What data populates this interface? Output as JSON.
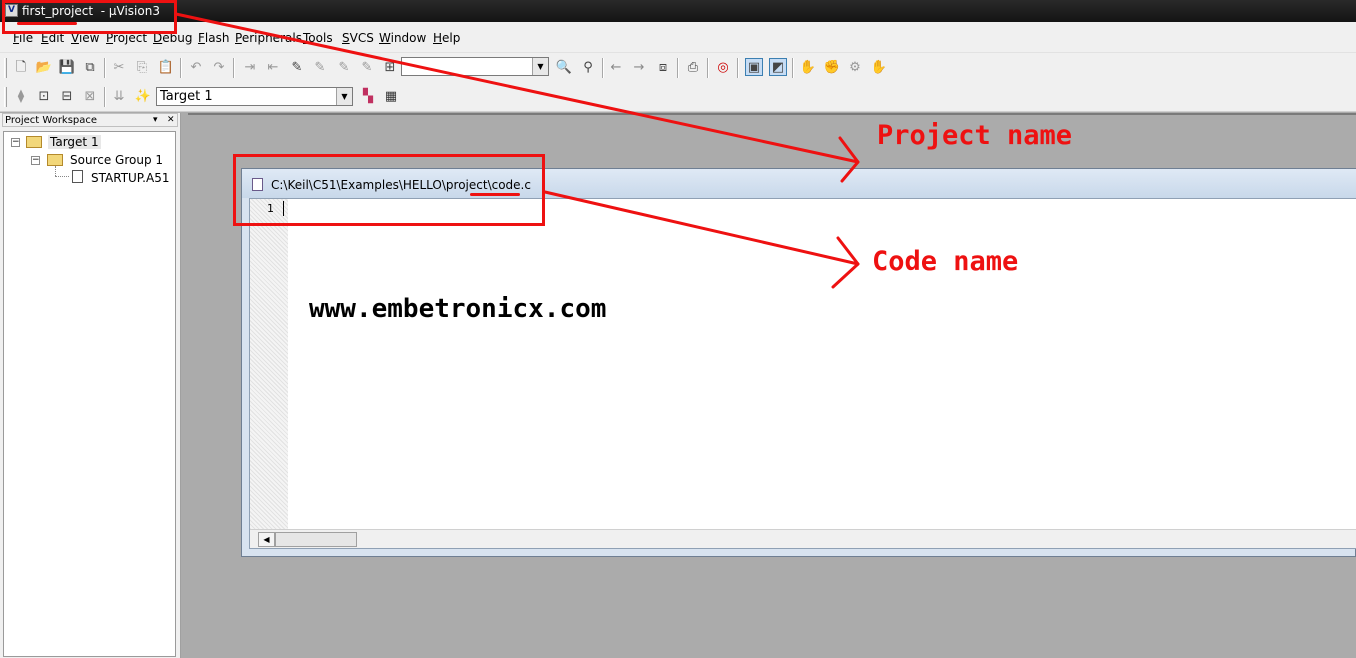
{
  "window": {
    "title": "first_project  - µVision3",
    "app_icon_glyph": "V"
  },
  "menu": [
    "File",
    "Edit",
    "View",
    "Project",
    "Debug",
    "Flash",
    "Peripherals",
    "Tools",
    "SVCS",
    "Window",
    "Help"
  ],
  "toolbar": {
    "target_combo": "Target 1",
    "find_combo": ""
  },
  "workspace": {
    "header": "Project Workspace",
    "tree": {
      "target": "Target 1",
      "group": "Source Group 1",
      "file": "STARTUP.A51"
    }
  },
  "editor": {
    "path": "C:\\Keil\\C51\\Examples\\HELLO\\project\\code.c",
    "line_number": "1"
  },
  "watermark": "www.embetronicx.com",
  "annotations": {
    "project_label": "Project name",
    "code_label": "Code name",
    "color": "#ee1111"
  }
}
